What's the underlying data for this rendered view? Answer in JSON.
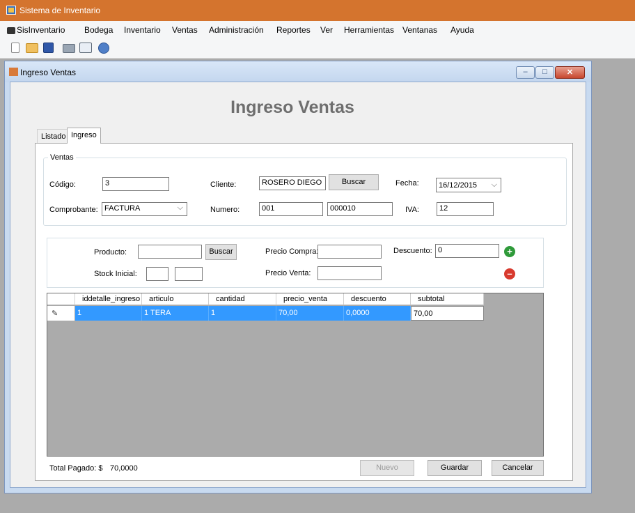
{
  "app": {
    "title": "Sistema de Inventario"
  },
  "menu": [
    "SisInventario",
    "Bodega",
    "Inventario",
    "Ventas",
    "Administración",
    "Reportes",
    "Ver",
    "Herramientas",
    "Ventanas",
    "Ayuda"
  ],
  "toolbar": {
    "icons": [
      "new-file-icon",
      "open-folder-icon",
      "save-icon",
      "print-icon",
      "print-preview-icon",
      "help-icon"
    ]
  },
  "window": {
    "title": "Ingreso Ventas",
    "minimize": "–",
    "maximize": "□",
    "close": "✕"
  },
  "heading": "Ingreso Ventas",
  "tabs": [
    "Listado",
    "Ingreso"
  ],
  "ventas": {
    "legend": "Ventas",
    "codigo_label": "Código:",
    "codigo": "3",
    "cliente_label": "Cliente:",
    "cliente": "ROSERO DIEGO",
    "buscar": "Buscar",
    "fecha_label": "Fecha:",
    "fecha": "16/12/2015",
    "comprobante_label": "Comprobante:",
    "comprobante": "FACTURA",
    "numero_label": "Numero:",
    "serie": "001",
    "numero": "000010",
    "iva_label": "IVA:",
    "iva": "12"
  },
  "producto": {
    "producto_label": "Producto:",
    "producto": "",
    "buscar": "Buscar",
    "precio_compra_label": "Precio Compra:",
    "precio_compra": "",
    "descuento_label": "Descuento:",
    "descuento": "0",
    "stock_label": "Stock Inicial:",
    "precio_venta_label": "Precio Venta:",
    "precio_venta": "",
    "add_glyph": "+",
    "remove_glyph": "–"
  },
  "grid": {
    "columns": [
      "iddetalle_ingreso",
      "articulo",
      "cantidad",
      "precio_venta",
      "descuento",
      "subtotal"
    ],
    "row_marker": "✎",
    "rows": [
      [
        "1",
        "1 TERA",
        "1",
        "70,00",
        "0,0000",
        "70,00"
      ]
    ]
  },
  "footer": {
    "total_label": "Total Pagado: $",
    "total": "70,0000",
    "nuevo": "Nuevo",
    "guardar": "Guardar",
    "cancelar": "Cancelar"
  },
  "colors": {
    "titlebar": "#d4742e",
    "selection": "#3399ff",
    "grid_bg": "#ababab"
  }
}
